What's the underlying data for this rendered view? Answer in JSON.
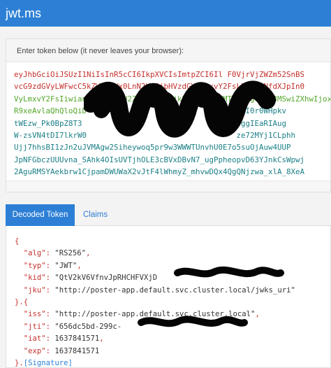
{
  "app": {
    "title": "jwt.ms"
  },
  "token_card": {
    "label": "Enter token below (it never leaves your browser):",
    "lines": [
      {
        "part": "header",
        "text": "eyJhbGciOiJSUzI1NiIsInR5cCI6IkpXVCIsImtpZCI6Il F0VjrVjZWZm52SnBS"
      },
      {
        "part": "header",
        "text": "vcG9zdGVyLWFwcC5kZWZhdWx0LnN2Yy5jbHVzdGVyLmxvY2FsL2p3a3NfdXJpIn0"
      },
      {
        "part": "payload",
        "text": "VyLmxvY2FsIiwianRpIjoiNjU2ZGM1YmQtMjk5Yy1ceWxvMTYzNzg0MTU3MSwiZXhwIjoxNjM3ODQxNTcxfQ"
      },
      {
        "part": "payload",
        "text": "R9xeAvlaQhQloQiD"
      },
      {
        "part": "sig",
        "text": "tWEzw_Pk0BpZ8T3"
      },
      {
        "part": "sig",
        "text": "W-zsVN4tDI7lkrW0"
      },
      {
        "part": "sig",
        "text": "Ujj7hhsBI1zJn2uJVMAgw2Siheywoq5pr9w3WWWTUnvhU0E7o5suOjAuw4UUP"
      },
      {
        "part": "sig",
        "text": "JpNFGbczUUUvna_SAhk4OIsUVTjhOLE3cBVxDBvN7_ugPpheopvD63YJnkCsWpwj"
      },
      {
        "part": "sig",
        "text": "2AguRMSYAekbrw1CjpamDWUWaX2vJtF4lWhmyZ_mhvwDQx4QgQNjzwa_xlA_8XeA"
      }
    ],
    "line_tails": {
      "line4": "6I0r0WHpkv",
      "line5": "tggIEaRIAug",
      "line6": "ze72MYj1CLphh"
    }
  },
  "tabs": [
    {
      "label": "Decoded Token",
      "active": true
    },
    {
      "label": "Claims",
      "active": false
    }
  ],
  "decoded": {
    "open1": "{",
    "alg_key": "\"alg\"",
    "alg_val": "\"RS256\"",
    "typ_key": "\"typ\"",
    "typ_val": "\"JWT\"",
    "kid_key": "\"kid\"",
    "kid_val": "\"QtV2kV6VfnvJpRHCHFVXjD",
    "jku_key": "\"jku\"",
    "jku_val": "\"http://poster-app.default.svc.cluster.local/jwks_uri\"",
    "close_open": "}.{",
    "iss_key": "\"iss\"",
    "iss_val": "\"http://poster-app.default.svc.cluster.local\"",
    "jti_key": "\"jti\"",
    "jti_val": "\"656dc5bd-299c-",
    "iat_key": "\"iat\"",
    "iat_val": "1637841571",
    "exp_key": "\"exp\"",
    "exp_val": "1637841571",
    "close_sig": "}.",
    "signature": "[Signature]"
  },
  "colors": {
    "brand_blue": "#2c7fd5",
    "header_red": "#c5302c",
    "payload_green": "#53a62b",
    "signature_teal": "#1a7f86"
  }
}
